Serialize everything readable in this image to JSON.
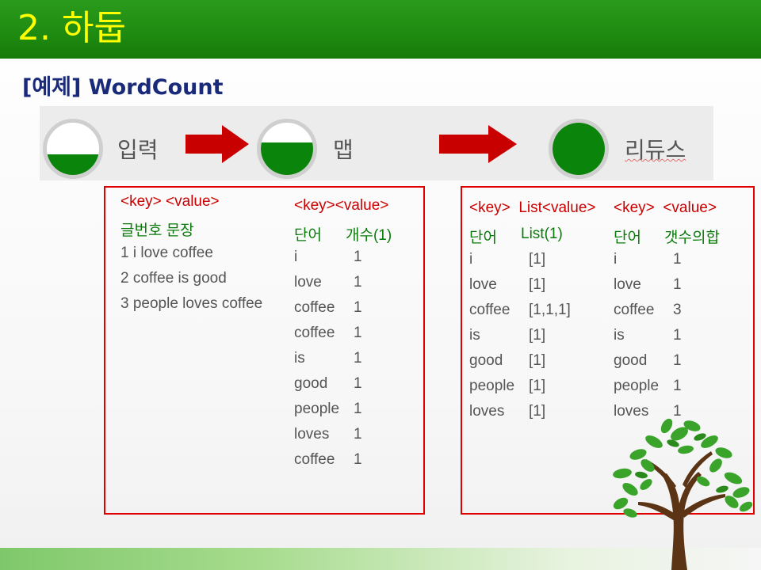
{
  "title": "2. 하둡",
  "subtitle": "[예제] WordCount",
  "flow": {
    "stages": [
      {
        "label": "입력",
        "fill_level": 0.4
      },
      {
        "label": "맵",
        "fill_level": 0.6
      },
      {
        "label": "리듀스",
        "fill_level": 1.0
      }
    ]
  },
  "input_table": {
    "header": "<key> <value>",
    "subheader": "글번호 문장",
    "rows": [
      "1 i love coffee",
      "2 coffee is good",
      "3 people loves coffee"
    ]
  },
  "map_table": {
    "header": "<key><value>",
    "col1": "단어",
    "col2": "개수(1)",
    "rows": [
      [
        "i",
        "1"
      ],
      [
        "love",
        "1"
      ],
      [
        "coffee",
        "1"
      ],
      [
        "coffee",
        "1"
      ],
      [
        "is",
        "1"
      ],
      [
        "good",
        "1"
      ],
      [
        "people",
        "1"
      ],
      [
        "loves",
        "1"
      ],
      [
        "coffee",
        "1"
      ]
    ]
  },
  "shuffle_table": {
    "header": "<key>  List<value>",
    "col1": "단어",
    "col2": "List(1)",
    "rows": [
      [
        "i",
        "[1]"
      ],
      [
        "love",
        "[1]"
      ],
      [
        "coffee",
        "[1,1,1]"
      ],
      [
        "is",
        "[1]"
      ],
      [
        "good",
        "[1]"
      ],
      [
        "people",
        "[1]"
      ],
      [
        "loves",
        "[1]"
      ]
    ]
  },
  "reduce_table": {
    "header": "<key>  <value>",
    "col1": "단어",
    "col2": "갯수의합",
    "rows": [
      [
        "i",
        "1"
      ],
      [
        "love",
        "1"
      ],
      [
        "coffee",
        "3"
      ],
      [
        "is",
        "1"
      ],
      [
        "good",
        "1"
      ],
      [
        "people",
        "1"
      ],
      [
        "loves",
        "1"
      ]
    ]
  },
  "colors": {
    "title_bg": "#1f8a10",
    "title_text": "#ffff00",
    "subtitle_text": "#1a2a7a",
    "circle_fill": "#0a840a",
    "arrow": "#c80000",
    "box_border": "#e00000",
    "header_text": "#cc0000",
    "label_text": "#0a7a0a"
  },
  "icons": [
    "tree-icon",
    "right-arrow-icon"
  ]
}
